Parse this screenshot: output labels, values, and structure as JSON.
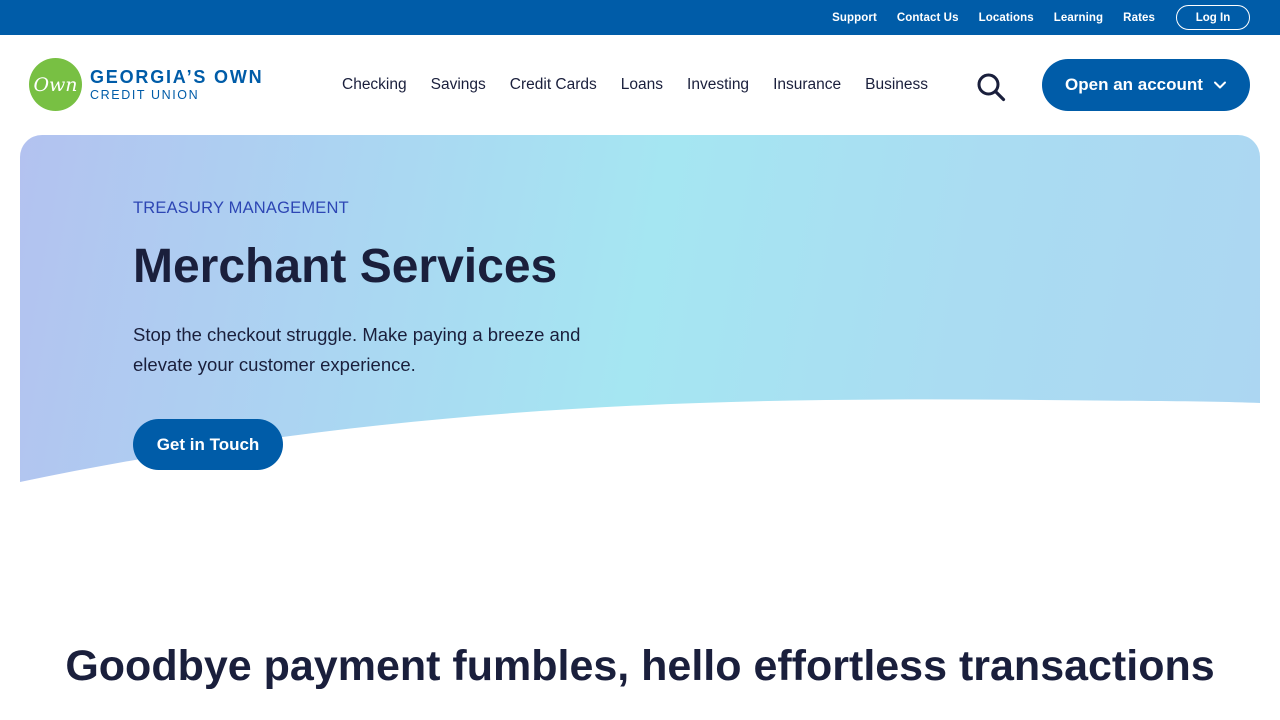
{
  "utility_nav": {
    "links": [
      "Support",
      "Contact Us",
      "Locations",
      "Learning",
      "Rates"
    ],
    "login_label": "Log In"
  },
  "logo": {
    "mark": "Own",
    "line1": "GEORGIA’S OWN",
    "line2": "CREDIT UNION",
    "mark_color": "#78c043",
    "brand_color": "#005ca8"
  },
  "main_nav": {
    "items": [
      "Checking",
      "Savings",
      "Credit Cards",
      "Loans",
      "Investing",
      "Insurance",
      "Business"
    ],
    "search_icon": "search-icon",
    "open_account_label": "Open an account",
    "open_account_icon": "chevron-down-icon"
  },
  "hero": {
    "eyebrow": "TREASURY MANAGEMENT",
    "title": "Merchant Services",
    "description": "Stop the checkout struggle. Make paying a breeze and elevate your customer experience.",
    "cta_label": "Get in Touch"
  },
  "section": {
    "heading": "Goodbye payment fumbles, hello effortless transactions"
  },
  "colors": {
    "primary": "#005ca8",
    "text_dark": "#1a1f3c",
    "eyebrow": "#2d46b4"
  }
}
